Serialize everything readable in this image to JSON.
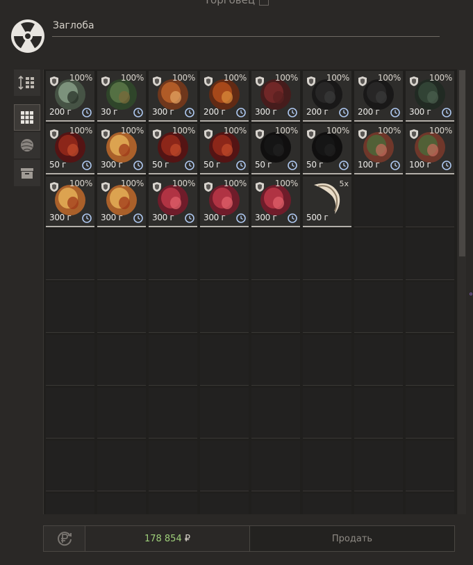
{
  "window": {
    "title": "Торговец"
  },
  "trader": {
    "name": "Заглоба"
  },
  "side_tabs": [
    {
      "icon": "sort-list-icon"
    },
    {
      "icon": "grid-icon",
      "active": true
    },
    {
      "icon": "artifact-icon"
    },
    {
      "icon": "box-icon"
    }
  ],
  "items": [
    {
      "name": "crystal-artifact",
      "durability": "100%",
      "price": "200 г",
      "colors": [
        "#4a5a4a",
        "#8aa28a",
        "#2a332a"
      ]
    },
    {
      "name": "green-moss-artifact",
      "durability": "100%",
      "price": "30 г",
      "colors": [
        "#2f4a2a",
        "#5e7a4a",
        "#7a6a3a"
      ]
    },
    {
      "name": "coil-artifact",
      "durability": "100%",
      "price": "300 г",
      "colors": [
        "#7a3a1a",
        "#c0642a",
        "#e0a060"
      ]
    },
    {
      "name": "flame-artifact",
      "durability": "100%",
      "price": "200 г",
      "colors": [
        "#6a2a10",
        "#b8501c",
        "#d88a3a"
      ]
    },
    {
      "name": "red-sponge-artifact",
      "durability": "100%",
      "price": "300 г",
      "colors": [
        "#4a1a1a",
        "#7a2a2a",
        "#5a2020"
      ]
    },
    {
      "name": "dark-chain-artifact",
      "durability": "100%",
      "price": "200 г",
      "colors": [
        "#151515",
        "#2a2a2a",
        "#3a3a3a"
      ]
    },
    {
      "name": "dark-chain-artifact",
      "durability": "100%",
      "price": "200 г",
      "colors": [
        "#151515",
        "#2a2a2a",
        "#3a3a3a"
      ]
    },
    {
      "name": "dark-green-artifact",
      "durability": "100%",
      "price": "300 г",
      "colors": [
        "#1e2a22",
        "#364a3a",
        "#4a5e4e"
      ]
    },
    {
      "name": "meat-artifact",
      "durability": "100%",
      "price": "50 г",
      "colors": [
        "#5a1010",
        "#9a2a1a",
        "#c04a2a"
      ]
    },
    {
      "name": "spiral-artifact",
      "durability": "100%",
      "price": "300 г",
      "colors": [
        "#c06a2a",
        "#e8b45a",
        "#a03a1a"
      ]
    },
    {
      "name": "meat-artifact",
      "durability": "100%",
      "price": "50 г",
      "colors": [
        "#5a1010",
        "#9a2a1a",
        "#c04a2a"
      ]
    },
    {
      "name": "meat-artifact",
      "durability": "100%",
      "price": "50 г",
      "colors": [
        "#5a1010",
        "#9a2a1a",
        "#c04a2a"
      ]
    },
    {
      "name": "black-leaf-artifact",
      "durability": "100%",
      "price": "50 г",
      "colors": [
        "#0a0a0a",
        "#161616",
        "#202020"
      ]
    },
    {
      "name": "black-leaf-artifact",
      "durability": "100%",
      "price": "50 г",
      "colors": [
        "#0a0a0a",
        "#161616",
        "#202020"
      ]
    },
    {
      "name": "flower-artifact",
      "durability": "100%",
      "price": "100 г",
      "colors": [
        "#7a3a2a",
        "#4a6a3a",
        "#c06a5a"
      ]
    },
    {
      "name": "flower-artifact",
      "durability": "100%",
      "price": "100 г",
      "colors": [
        "#7a3a2a",
        "#4a6a3a",
        "#c06a5a"
      ]
    },
    {
      "name": "spiral-artifact",
      "durability": "100%",
      "price": "300 г",
      "colors": [
        "#c06a2a",
        "#e8b45a",
        "#a03a1a"
      ]
    },
    {
      "name": "spiral-artifact",
      "durability": "100%",
      "price": "300 г",
      "colors": [
        "#c06a2a",
        "#e8b45a",
        "#a03a1a"
      ]
    },
    {
      "name": "red-crystal-artifact",
      "durability": "100%",
      "price": "300 г",
      "colors": [
        "#7a1a2a",
        "#c03a4a",
        "#e0606a"
      ]
    },
    {
      "name": "red-crystal-artifact",
      "durability": "100%",
      "price": "300 г",
      "colors": [
        "#7a1a2a",
        "#c03a4a",
        "#e0606a"
      ]
    },
    {
      "name": "red-crystal-artifact",
      "durability": "100%",
      "price": "300 г",
      "colors": [
        "#7a1a2a",
        "#c03a4a",
        "#e0606a"
      ]
    },
    {
      "name": "claw-item",
      "quantity": "5x",
      "price": "500 г",
      "colors": [
        "#e8dcc8",
        "#b8a890",
        "#5a4a3a"
      ]
    }
  ],
  "footer": {
    "money": "178 854",
    "currency": "₽",
    "sell_label": "Продать"
  }
}
